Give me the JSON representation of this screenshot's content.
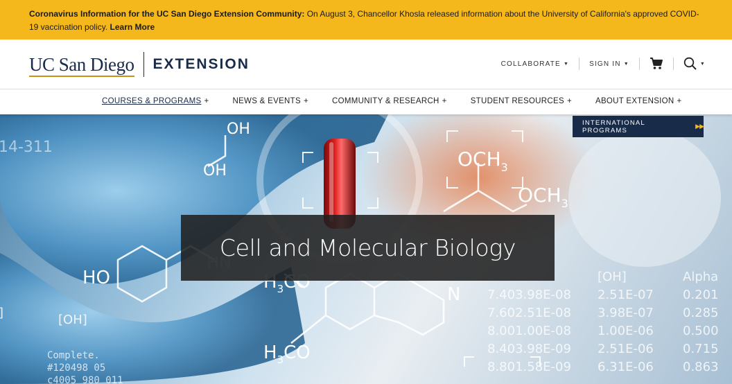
{
  "alert": {
    "title": "Coronavirus Information for the UC San Diego Extension Community:",
    "message": " On August 3, Chancellor Khosla released information about the University of California's approved COVID-19 vaccination policy. ",
    "link": "Learn More"
  },
  "header": {
    "logo_ucsd": "UC San Diego",
    "logo_ext": "EXTENSION",
    "utility": {
      "collaborate": "COLLABORATE",
      "sign_in": "SIGN IN"
    }
  },
  "nav": {
    "items": [
      {
        "label": "COURSES & PROGRAMS"
      },
      {
        "label": "NEWS & EVENTS"
      },
      {
        "label": "COMMUNITY & RESEARCH"
      },
      {
        "label": "STUDENT RESOURCES"
      },
      {
        "label": "ABOUT EXTENSION"
      }
    ]
  },
  "hero": {
    "intl_button": "INTERNATIONAL PROGRAMS",
    "title": "Cell and Molecular Biology",
    "chem_labels": {
      "oh1": "OH",
      "oh2": "OH",
      "och3a": "OCH",
      "och3b": "OCH",
      "ho": "HO",
      "hn": "HN",
      "h3co1": "H",
      "h3co2": "H",
      "n": "N",
      "oh_bracket": "[OH]",
      "num": "14-311"
    },
    "table": {
      "headers": [
        "[OH]",
        "Alpha"
      ],
      "col1": [
        "7.403.98E-08",
        "7.602.51E-08",
        "8.001.00E-08",
        "8.403.98E-09",
        "8.801.58E-09"
      ],
      "col2": [
        "2.51E-07",
        "3.98E-07",
        "1.00E-06",
        "2.51E-06",
        "6.31E-06"
      ],
      "col3": [
        "0.201",
        "0.285",
        "0.500",
        "0.715",
        "0.863"
      ]
    },
    "console": [
      "Complete.",
      "#120498 05",
      "c4005 980 011"
    ]
  },
  "colors": {
    "alert_bg": "#f5b81c",
    "navy": "#182b49",
    "gold": "#c69214"
  }
}
